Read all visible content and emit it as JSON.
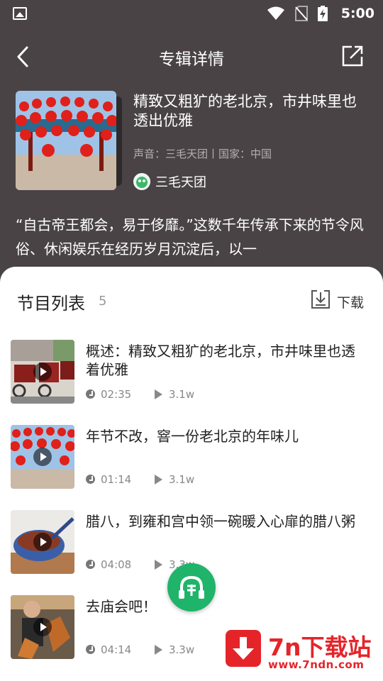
{
  "status_bar": {
    "time": "5:00"
  },
  "header": {
    "title": "专辑详情"
  },
  "album": {
    "title": "精致又粗犷的老北京，市井味里也透出优雅",
    "meta": "声音：三毛天团丨国家：中国",
    "author": "三毛天团",
    "description": "“自古帝王都会，易于侈靡。”这数千年传承下来的节令风俗、休闲娱乐在经历岁月沉淀后，以一"
  },
  "episode_list": {
    "title": "节目列表",
    "count": "5",
    "download_label": "下载",
    "items": [
      {
        "title": "概述：精致又粗犷的老北京，市井味里也透着优雅",
        "duration": "02:35",
        "plays": "3.1w"
      },
      {
        "title": "年节不改，窨一份老北京的年味儿",
        "duration": "01:14",
        "plays": "3.1w"
      },
      {
        "title": "腊八，到雍和宫中领一碗暖入心扉的腊八粥",
        "duration": "04:08",
        "plays": "3.3w"
      },
      {
        "title": "去庙会吧！",
        "duration": "04:14",
        "plays": "3.3w"
      }
    ]
  },
  "watermark": {
    "brand": "7n下载站",
    "url": "www.7ndn.com"
  },
  "colors": {
    "header_bg": "#4a4346",
    "accent_green": "#1fb46a",
    "watermark_red": "#e5242a"
  },
  "icons": [
    "image-icon",
    "wifi-icon",
    "no-sim-icon",
    "battery-charging-icon",
    "back-arrow-icon",
    "share-icon",
    "download-icon",
    "clock-icon",
    "play-count-icon",
    "play-icon",
    "headphones-icon"
  ]
}
